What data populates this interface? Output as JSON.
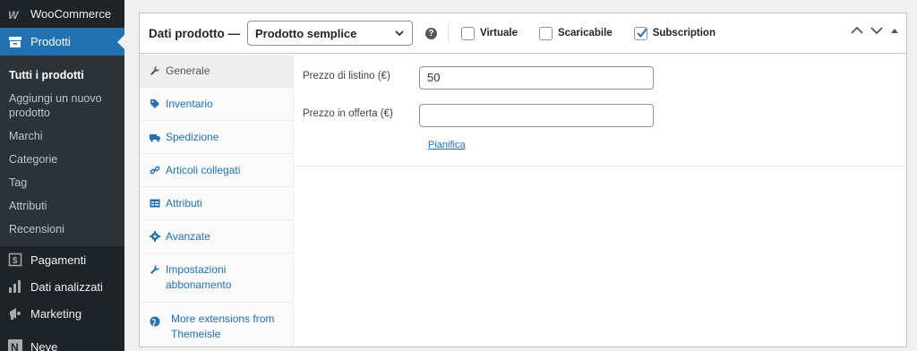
{
  "sidebar": {
    "top_items": [
      {
        "label": "WooCommerce",
        "icon": "woocommerce-icon"
      },
      {
        "label": "Prodotti",
        "icon": "archive-icon"
      }
    ],
    "submenu": [
      "Tutti i prodotti",
      "Aggiungi un nuovo prodotto",
      "Marchi",
      "Categorie",
      "Tag",
      "Attributi",
      "Recensioni"
    ],
    "bottom_items": [
      {
        "label": "Pagamenti",
        "icon": "dollar-icon"
      },
      {
        "label": "Dati analizzati",
        "icon": "chart-bar-icon"
      },
      {
        "label": "Marketing",
        "icon": "megaphone-icon"
      },
      {
        "label": "Neve",
        "icon": "neve-logo-icon"
      }
    ]
  },
  "product_data": {
    "title": "Dati prodotto —",
    "type_select": {
      "selected": "Prodotto semplice"
    },
    "help": "?",
    "options": [
      {
        "label": "Virtuale",
        "checked": false
      },
      {
        "label": "Scaricabile",
        "checked": false
      },
      {
        "label": "Subscription",
        "checked": true
      }
    ],
    "tabs": [
      {
        "label": "Generale",
        "icon": "wrench-icon"
      },
      {
        "label": "Inventario",
        "icon": "tag-icon"
      },
      {
        "label": "Spedizione",
        "icon": "truck-icon"
      },
      {
        "label": "Articoli collegati",
        "icon": "link-icon"
      },
      {
        "label": "Attributi",
        "icon": "table-icon"
      },
      {
        "label": "Avanzate",
        "icon": "gear-icon"
      },
      {
        "label": "Impostazioni abbonamento",
        "icon": "wrench-icon"
      },
      {
        "label": "More extensions from Themeisle",
        "icon": "globe-icon"
      }
    ],
    "general": {
      "regular_price_label": "Prezzo di listino (€)",
      "regular_price_value": "50",
      "sale_price_label": "Prezzo in offerta (€)",
      "sale_price_value": "",
      "schedule_link": "Pianifica"
    }
  },
  "colors": {
    "sidebar_bg": "#1d2327",
    "accent": "#2271b1",
    "submenu_bg": "#2c3338"
  }
}
